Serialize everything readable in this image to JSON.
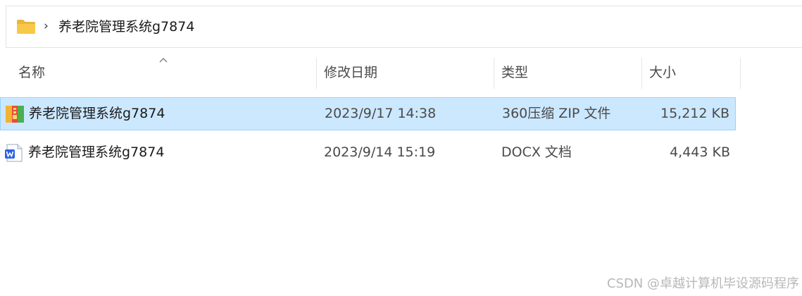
{
  "breadcrumb": {
    "separator": "›",
    "current": "养老院管理系统g7874"
  },
  "columns": {
    "name": "名称",
    "date": "修改日期",
    "type": "类型",
    "size": "大小"
  },
  "files": [
    {
      "name": "养老院管理系统g7874",
      "date": "2023/9/17 14:38",
      "type": "360压缩 ZIP 文件",
      "size": "15,212 KB",
      "icon": "zip-archive-icon",
      "selected": true
    },
    {
      "name": "养老院管理系统g7874",
      "date": "2023/9/14 15:19",
      "type": "DOCX 文档",
      "size": "4,443 KB",
      "icon": "wps-docx-icon",
      "selected": false
    }
  ],
  "watermark": "CSDN @卓越计算机毕设源码程序",
  "colors": {
    "selection_bg": "#cce8ff",
    "selection_border": "#99d1ff",
    "folder_yellow": "#f8c948",
    "wps_blue": "#2b63e8"
  }
}
